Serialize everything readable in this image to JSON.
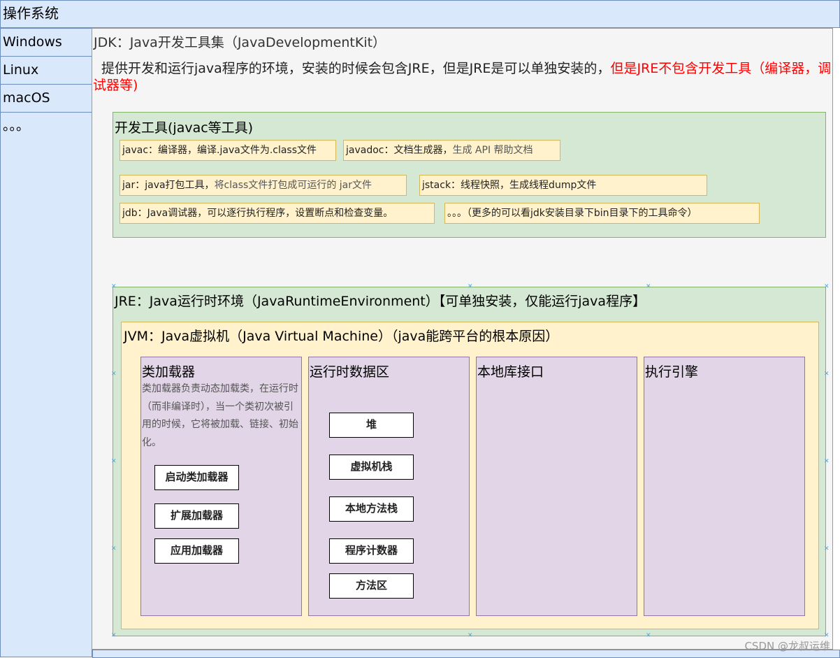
{
  "os": {
    "title": "操作系统",
    "items": [
      "Windows",
      "Linux",
      "macOS",
      "。。。"
    ]
  },
  "jdk": {
    "title": "JDK：Java开发工具集（JavaDevelopmentKit）",
    "desc_black": "提供开发和运行java程序的环境，安装的时候会包含JRE，但是JRE是可以单独安装的，",
    "desc_red": "但是JRE不包含开发工具（编译器，调试器等)"
  },
  "dev_tools": {
    "title": "开发工具(javac等工具)",
    "tools": [
      {
        "main": "javac：编译器，编译.java文件为.class文件",
        "extra": ""
      },
      {
        "main": "javadoc：文档生成器，",
        "extra": "生成 API 帮助文档"
      },
      {
        "main": "jar：java打包工具，",
        "extra": "将class文件打包成可运行的 jar文件"
      },
      {
        "main": "jstack：线程快照，生成线程dump文件",
        "extra": ""
      },
      {
        "main": "jdb：Java调试器，可以逐行执行程序，设置断点和检查变量。",
        "extra": ""
      },
      {
        "main": "。。。（更多的可以看jdk安装目录下bin目录下的工具命令）",
        "extra": ""
      }
    ]
  },
  "jre": {
    "title": "JRE：Java运行时环境（JavaRuntimeEnvironment）【可单独安装，仅能运行java程序】"
  },
  "jvm": {
    "title": "JVM：Java虚拟机（Java Virtual Machine）（java能跨平台的根本原因）",
    "class_loader": {
      "title": "类加载器",
      "desc": "类加载器负责动态加载类，在运行时（而非编译时），当一个类初次被引用的时候，它将被加载、链接、初始化。",
      "loaders": [
        "启动类加载器",
        "扩展加载器",
        "应用加载器"
      ]
    },
    "runtime_data": {
      "title": "运行时数据区",
      "areas": [
        "堆",
        "虚拟机栈",
        "本地方法栈",
        "程序计数器",
        "方法区"
      ]
    },
    "native_interface": {
      "title": "本地库接口"
    },
    "execution_engine": {
      "title": "执行引擎"
    }
  },
  "watermark": "CSDN @龙叔运维"
}
